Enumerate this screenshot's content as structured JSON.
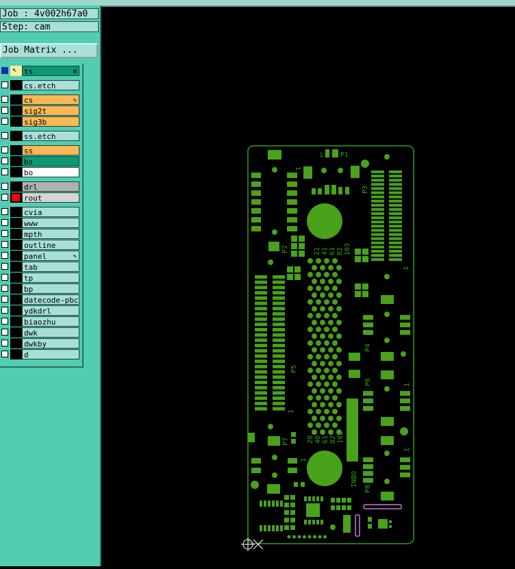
{
  "job": {
    "label": "Job : 4v002h67a0"
  },
  "step": {
    "label": "Step: cam"
  },
  "job_matrix": {
    "label": "Job Matrix ..."
  },
  "layers": [
    {
      "name": "ts",
      "color": "#0a9a73",
      "state": "active"
    },
    {
      "name": "cs.etch",
      "color": "#a9e0d6"
    },
    {
      "name": "cs",
      "color": "#fcb855",
      "mark": "pencil"
    },
    {
      "name": "sig2t",
      "color": "#fcb855"
    },
    {
      "name": "sig3b",
      "color": "#fcb855"
    },
    {
      "name": "ss.etch",
      "color": "#a9e0d6"
    },
    {
      "name": "ss",
      "color": "#fcb855"
    },
    {
      "name": "bs",
      "color": "#0a9a73"
    },
    {
      "name": "bo",
      "color": "#ffffff"
    },
    {
      "name": "drl",
      "color": "#b0b0b0"
    },
    {
      "name": "rout",
      "color": "#d6d6d6",
      "swatch": "#ff0000"
    },
    {
      "name": "cvia",
      "color": "#a9e0d6"
    },
    {
      "name": "www",
      "color": "#a9e0d6"
    },
    {
      "name": "mpth",
      "color": "#a9e0d6"
    },
    {
      "name": "outline",
      "color": "#a9e0d6"
    },
    {
      "name": "panel",
      "color": "#a9e0d6",
      "mark": "pencil"
    },
    {
      "name": "tab",
      "color": "#a9e0d6"
    },
    {
      "name": "tp",
      "color": "#a9e0d6"
    },
    {
      "name": "bp",
      "color": "#a9e0d6"
    },
    {
      "name": "datecode-pbc",
      "color": "#a9e0d6"
    },
    {
      "name": "ydkdrl",
      "color": "#a9e0d6"
    },
    {
      "name": "biaozhu",
      "color": "#a9e0d6"
    },
    {
      "name": "dwk",
      "color": "#a9e0d6"
    },
    {
      "name": "dwkby",
      "color": "#a9e0d6"
    },
    {
      "name": "d",
      "color": "#a9e0d6"
    }
  ],
  "board": {
    "silk_color": "#2f9e10",
    "pad_color": "#48a21a",
    "highlight_color": "#c27bdc",
    "labels": {
      "p1": "P1",
      "p2": "P2",
      "p3": "P3",
      "p4": "P4",
      "p5": "P5",
      "p6": "P6",
      "p7": "P7",
      "p8": "P8",
      "inbo": "INBO",
      "n1": "1",
      "row_top": [
        "21",
        "41",
        "61",
        "82",
        "103"
      ],
      "row_bottom": [
        "20",
        "40",
        "61",
        "82",
        "102"
      ]
    }
  }
}
